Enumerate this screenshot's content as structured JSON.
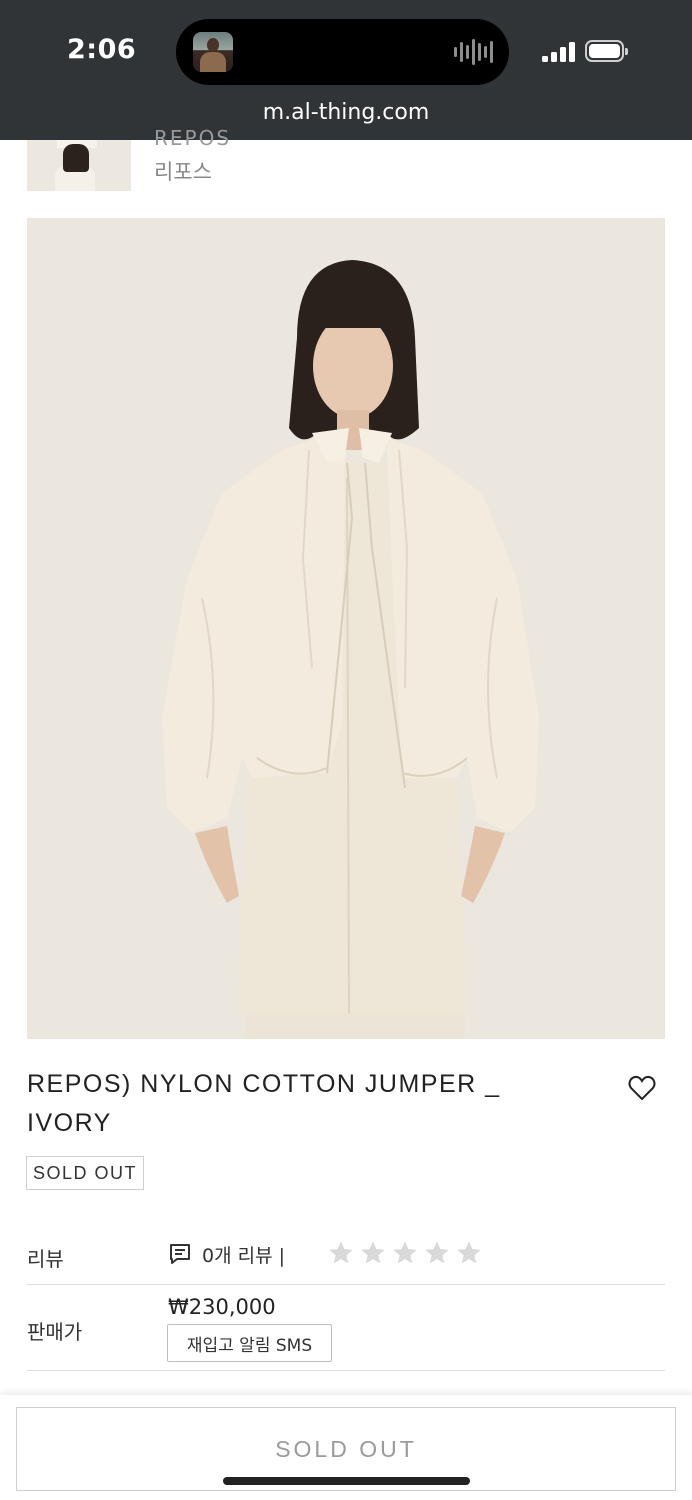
{
  "status_bar": {
    "time": "2:06",
    "url": "m.al-thing.com"
  },
  "brand": {
    "name_en": "REPOS",
    "name_ko": "리포스"
  },
  "product": {
    "title": "REPOS) NYLON COTTON JUMPER _ IVORY",
    "status_badge": "SOLD OUT",
    "image_alt_icon": "product-photo"
  },
  "details": {
    "review_label": "리뷰",
    "review_text": "0개 리뷰 |",
    "rating": 0,
    "rating_max": 5,
    "price_label": "판매가",
    "price": "₩230,000",
    "sms_button": "재입고 알림 SMS"
  },
  "bottom": {
    "button_label": "SOLD OUT"
  },
  "colors": {
    "status_bar_bg": "#303436",
    "image_bg": "#ebe7df",
    "star_empty": "#d9d9d9",
    "disabled_text": "#9a9a9a"
  }
}
